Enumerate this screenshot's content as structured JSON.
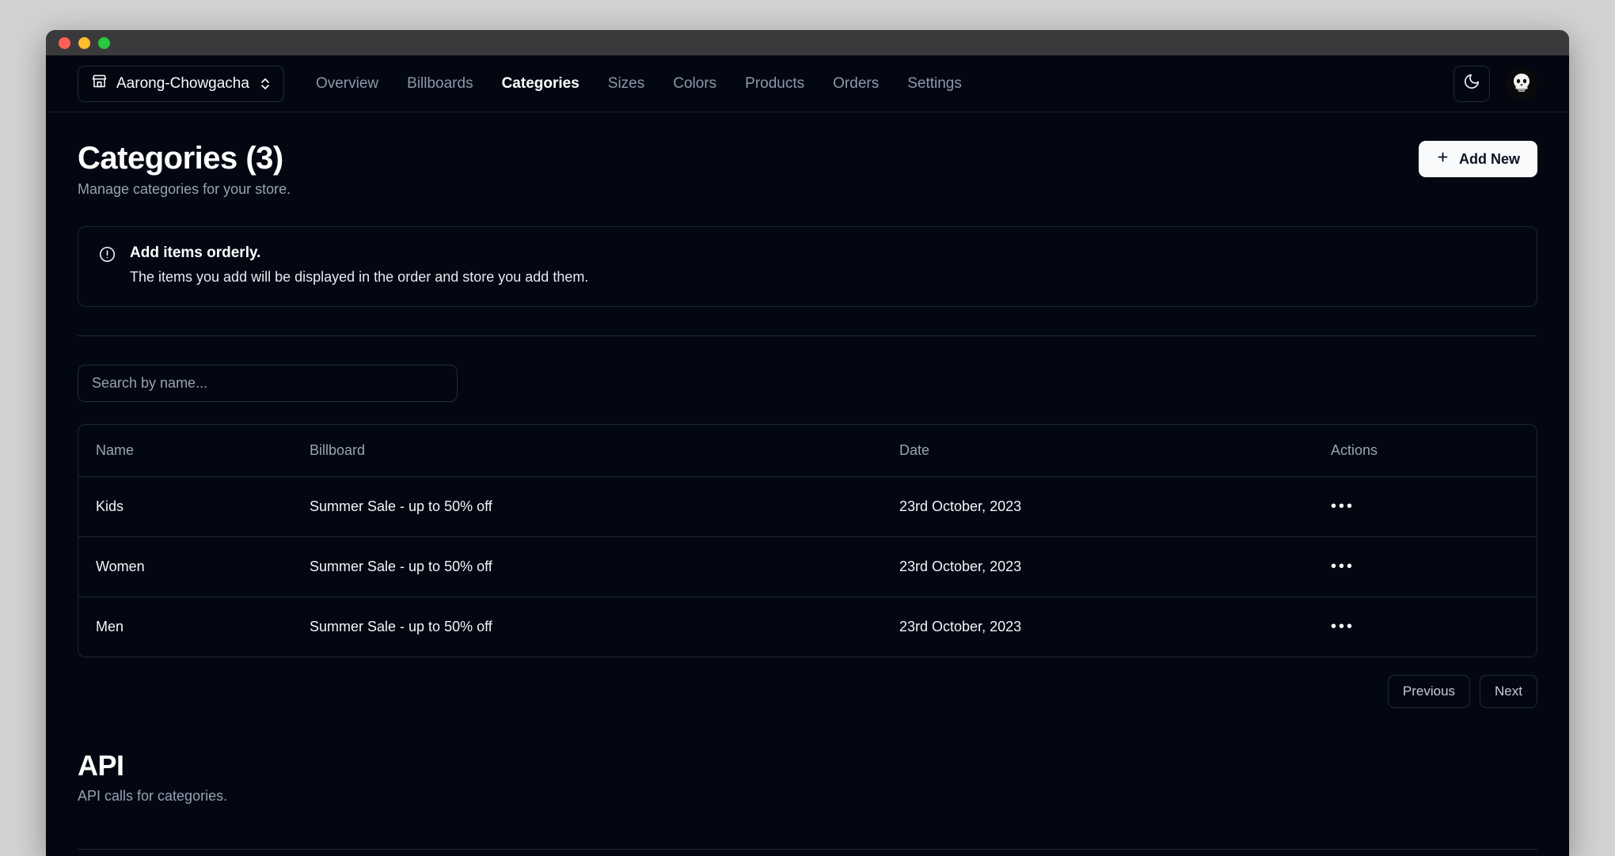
{
  "window": {
    "traffic_lights": [
      "close",
      "minimize",
      "zoom"
    ],
    "colors": {
      "close": "#ff5f57",
      "minimize": "#febc2e",
      "zoom": "#28c840",
      "app_background": "#030712",
      "desktop_background": "#d2d2d2",
      "border": "#1e2638",
      "muted_text": "#98a1b2",
      "accent_button": "#f8fafc"
    }
  },
  "navbar": {
    "store_switcher": {
      "icon": "store-icon",
      "label": "Aarong-Chowgacha",
      "chevron": "chevron-up-down-icon"
    },
    "links": [
      {
        "label": "Overview",
        "active": false
      },
      {
        "label": "Billboards",
        "active": false
      },
      {
        "label": "Categories",
        "active": true
      },
      {
        "label": "Sizes",
        "active": false
      },
      {
        "label": "Colors",
        "active": false
      },
      {
        "label": "Products",
        "active": false
      },
      {
        "label": "Orders",
        "active": false
      },
      {
        "label": "Settings",
        "active": false
      }
    ],
    "theme_toggle_icon": "moon-icon",
    "avatar_icon": "user-avatar"
  },
  "page": {
    "title": "Categories (3)",
    "subtitle": "Manage categories for your store.",
    "add_button": {
      "label": "Add New",
      "icon": "plus-icon"
    }
  },
  "alert": {
    "icon": "alert-circle-icon",
    "title": "Add items orderly.",
    "description": "The items you add will be displayed in the order and store you add them."
  },
  "search": {
    "placeholder": "Search by name...",
    "value": ""
  },
  "table": {
    "columns": [
      "Name",
      "Billboard",
      "Date",
      "Actions"
    ],
    "rows": [
      {
        "name": "Kids",
        "billboard": "Summer Sale - up to 50% off",
        "date": "23rd October, 2023",
        "actions_icon": "ellipsis-horizontal-icon"
      },
      {
        "name": "Women",
        "billboard": "Summer Sale - up to 50% off",
        "date": "23rd October, 2023",
        "actions_icon": "ellipsis-horizontal-icon"
      },
      {
        "name": "Men",
        "billboard": "Summer Sale - up to 50% off",
        "date": "23rd October, 2023",
        "actions_icon": "ellipsis-horizontal-icon"
      }
    ]
  },
  "pagination": {
    "previous_label": "Previous",
    "next_label": "Next"
  },
  "api_section": {
    "title": "API",
    "subtitle": "API calls for categories."
  }
}
